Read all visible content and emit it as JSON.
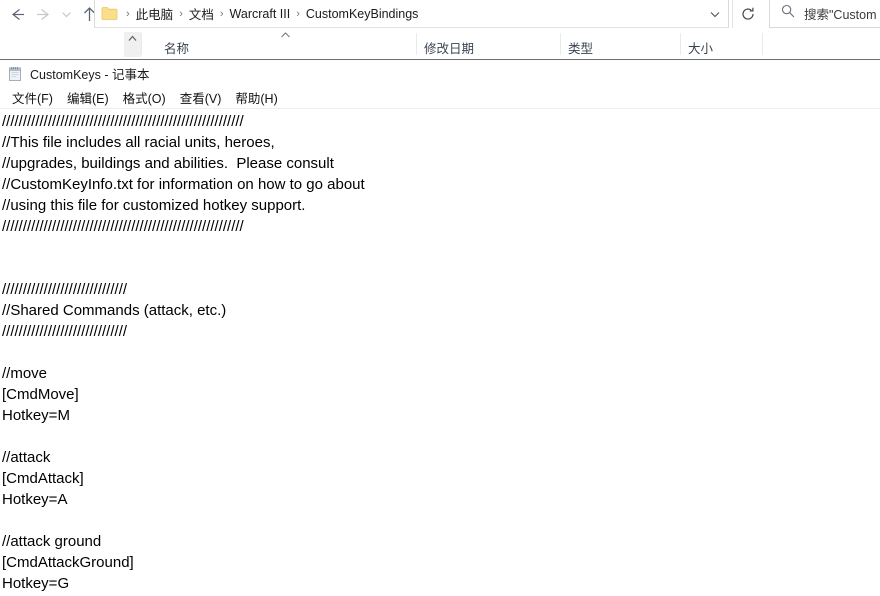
{
  "explorer": {
    "nav": {
      "back_icon": "arrow-left-icon",
      "forward_icon": "arrow-right-icon",
      "recent_icon": "chevron-down-icon",
      "up_icon": "arrow-up-icon"
    },
    "address_bar": {
      "folder_icon": "folder-icon",
      "breadcrumbs": [
        "此电脑",
        "文档",
        "Warcraft III",
        "CustomKeyBindings"
      ],
      "separator": "›",
      "history_chevron_icon": "chevron-down-icon",
      "refresh_icon": "refresh-icon"
    },
    "search": {
      "icon": "search-icon",
      "placeholder": "搜索\"Custom"
    },
    "columns": [
      {
        "label": "名称"
      },
      {
        "label": "修改日期"
      },
      {
        "label": "类型"
      },
      {
        "label": "大小"
      }
    ],
    "sort_indicator_icon": "chevron-up-icon",
    "scroll_up_icon": "chevron-up-icon"
  },
  "notepad": {
    "icon": "notepad-icon",
    "title": "CustomKeys - 记事本",
    "menu": [
      {
        "label": "文件(F)"
      },
      {
        "label": "编辑(E)"
      },
      {
        "label": "格式(O)"
      },
      {
        "label": "查看(V)"
      },
      {
        "label": "帮助(H)"
      }
    ],
    "document_lines": [
      "//////////////////////////////////////////////////////////",
      "//This file includes all racial units, heroes,",
      "//upgrades, buildings and abilities.  Please consult",
      "//CustomKeyInfo.txt for information on how to go about",
      "//using this file for customized hotkey support.",
      "//////////////////////////////////////////////////////////",
      "",
      "",
      "//////////////////////////////",
      "//Shared Commands (attack, etc.)",
      "//////////////////////////////",
      "",
      "//move",
      "[CmdMove]",
      "Hotkey=M",
      "",
      "//attack",
      "[CmdAttack]",
      "Hotkey=A",
      "",
      "//attack ground",
      "[CmdAttackGround]",
      "Hotkey=G"
    ]
  },
  "colors": {
    "folder_yellow": "#fbd96a",
    "text": "#000000",
    "header_text": "#3a4450",
    "icon_gray": "#5a6573"
  }
}
